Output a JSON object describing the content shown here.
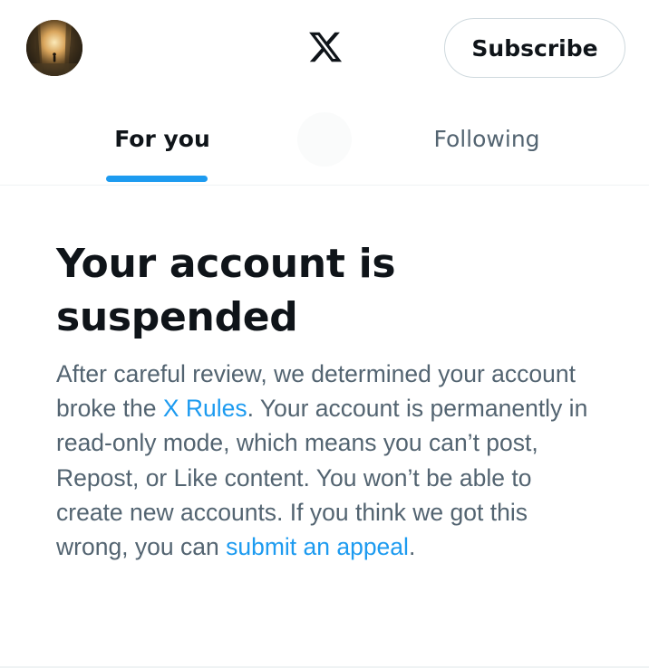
{
  "header": {
    "subscribe_label": "Subscribe",
    "logo_icon": "x-logo-icon",
    "avatar_icon": "profile-avatar"
  },
  "tabs": [
    {
      "label": "For you",
      "selected": true
    },
    {
      "label": "Following",
      "selected": false
    }
  ],
  "notice": {
    "title_line1": "Your account is",
    "title_line2": "suspended",
    "body_part1": "After careful review, we determined your account broke the ",
    "rules_link": "X Rules",
    "body_part2": ". Your account is permanently in read-only mode, which means you can’t post, Repost, or Like content. You won’t be able to create new accounts. If you think we got this wrong, you can ",
    "appeal_link": "submit an appeal",
    "body_part3": "."
  },
  "colors": {
    "accent": "#1d9bf0",
    "text_primary": "#0f1419",
    "text_secondary": "#536471",
    "border": "#cfd9de"
  }
}
